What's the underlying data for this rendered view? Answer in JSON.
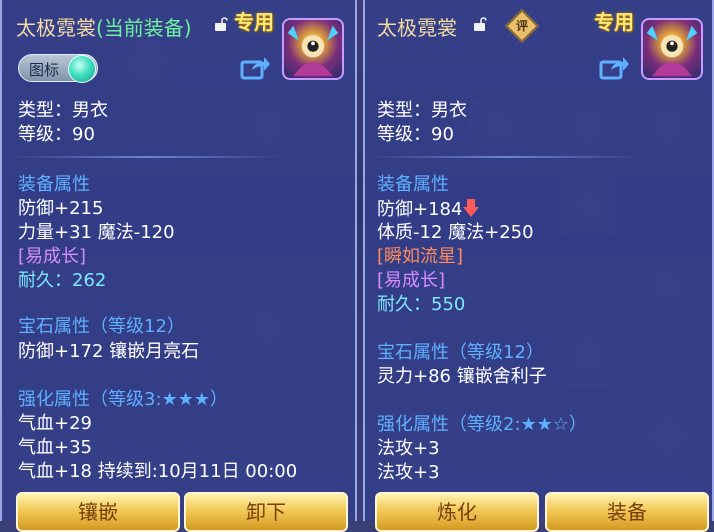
{
  "left": {
    "title": "太极霓裳",
    "equipped_tag": "(当前装备)",
    "exclusive": "专用",
    "toggle_label": "图标",
    "type_line": "类型：男衣",
    "level_line": "等级：90",
    "equip_attr_header": "装备属性",
    "attrs": [
      "防御+215",
      "力量+31 魔法-120"
    ],
    "trait": "[易成长]",
    "durability": "耐久：262",
    "gem_header": "宝石属性（等级12）",
    "gem_line": "防御+172 镶嵌月亮石",
    "enhance_header": "强化属性（等级3:★★★）",
    "enhance_lines": [
      "气血+29",
      "气血+35",
      "气血+18    持续到:10月11日 00:00"
    ],
    "buttons": [
      "镶嵌",
      "卸下"
    ]
  },
  "right": {
    "title": "太极霓裳",
    "rating_badge": "评",
    "exclusive": "专用",
    "type_line": "类型：男衣",
    "level_line": "等级：90",
    "equip_attr_header": "装备属性",
    "attrs": [
      "防御+184",
      "体质-12 魔法+250"
    ],
    "special": "[瞬如流星]",
    "trait": "[易成长]",
    "durability": "耐久：550",
    "gem_header": "宝石属性（等级12）",
    "gem_line": "灵力+86 镶嵌舍利子",
    "enhance_header": "强化属性（等级2:★★☆）",
    "enhance_lines": [
      "法攻+3",
      "法攻+3"
    ],
    "buttons": [
      "炼化",
      "装备"
    ]
  },
  "icons": {
    "lock": "unlock-icon",
    "share": "share-icon",
    "attr_change": "arrow-down-icon",
    "portrait": "character-portrait"
  },
  "colors": {
    "panel_bg": "#34408c",
    "section_blue": "#5fb0ff",
    "trait_purple": "#d68cff",
    "durability_cyan": "#7ee8ff",
    "button_gold": "#f1c957"
  }
}
